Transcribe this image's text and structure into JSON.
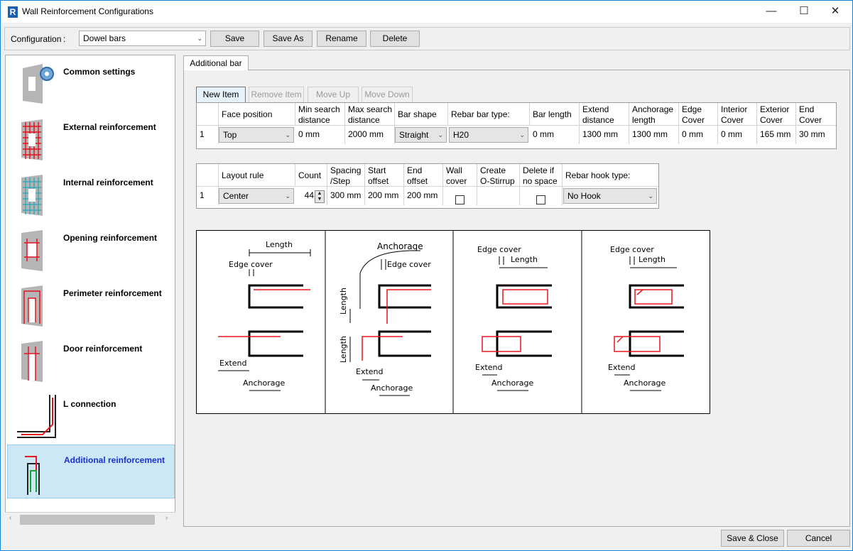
{
  "window": {
    "title": "Wall Reinforcement Configurations",
    "app_icon_letter": "R"
  },
  "toolbar": {
    "configuration_label": "Configuration",
    "separator": ":",
    "configuration_value": "Dowel bars",
    "save": "Save",
    "save_as": "Save As",
    "rename": "Rename",
    "delete": "Delete"
  },
  "sidebar": {
    "items": [
      {
        "label": "Common settings",
        "icon": "gear-wall-icon"
      },
      {
        "label": "External reinforcement",
        "icon": "external-mesh-icon"
      },
      {
        "label": "Internal reinforcement",
        "icon": "internal-mesh-icon"
      },
      {
        "label": "Opening reinforcement",
        "icon": "opening-rebar-icon"
      },
      {
        "label": "Perimeter reinforcement",
        "icon": "perimeter-rebar-icon"
      },
      {
        "label": "Door reinforcement",
        "icon": "door-rebar-icon"
      },
      {
        "label": "L connection",
        "icon": "l-connection-icon"
      },
      {
        "label": "Additional reinforcement",
        "icon": "additional-rebar-icon",
        "selected": true
      }
    ]
  },
  "tab": {
    "label": "Additional bar"
  },
  "item_buttons": {
    "new": "New Item",
    "remove": "Remove Item",
    "move_up": "Move Up",
    "move_down": "Move Down"
  },
  "bar_table": {
    "headers": [
      "Face position",
      "Min search\ndistance",
      "Max search\ndistance",
      "Bar shape",
      "Rebar bar type:",
      "Bar length",
      "Extend\ndistance",
      "Anchorage\nlength",
      "Edge\nCover",
      "Interior\nCover",
      "Exterior\nCover",
      "End\nCover"
    ],
    "row": {
      "index": "1",
      "face_position": "Top",
      "min_search": "0 mm",
      "max_search": "2000 mm",
      "bar_shape": "Straight",
      "bar_type": "H20",
      "bar_length": "0 mm",
      "extend": "1300 mm",
      "anchorage": "1300 mm",
      "edge_cover": "0 mm",
      "interior_cover": "0 mm",
      "exterior_cover": "165 mm",
      "end_cover": "30 mm"
    }
  },
  "layout_table": {
    "headers": [
      "Layout rule",
      "Count",
      "Spacing\n/Step",
      "Start\noffset",
      "End\noffset",
      "Wall\ncover",
      "Create\nO-Stirrup",
      "Delete if\nno space",
      "Rebar hook type:"
    ],
    "row": {
      "index": "1",
      "layout_rule": "Center",
      "count": "44",
      "spacing": "300 mm",
      "start_offset": "200 mm",
      "end_offset": "200 mm",
      "wall_cover": false,
      "delete_if_no_space": false,
      "hook_type": "No Hook"
    }
  },
  "diagram": {
    "p1": {
      "length": "Length",
      "edge_cover": "Edge cover",
      "extend": "Extend",
      "anchorage": "Anchorage"
    },
    "p2": {
      "anchorage_top": "Anchorage",
      "edge_cover": "Edge cover",
      "length1": "Length",
      "length2": "Length",
      "extend": "Extend",
      "anchorage": "Anchorage"
    },
    "p3": {
      "edge_cover": "Edge cover",
      "length": "Length",
      "extend": "Extend",
      "anchorage": "Anchorage"
    },
    "p4": {
      "edge_cover": "Edge cover",
      "length": "Length",
      "extend": "Extend",
      "anchorage": "Anchorage"
    }
  },
  "footer": {
    "save_close": "Save & Close",
    "cancel": "Cancel"
  },
  "colors": {
    "rebar": "#e8141e",
    "selected_bg": "#cce8f4",
    "selected_text": "#1a2fd6"
  }
}
